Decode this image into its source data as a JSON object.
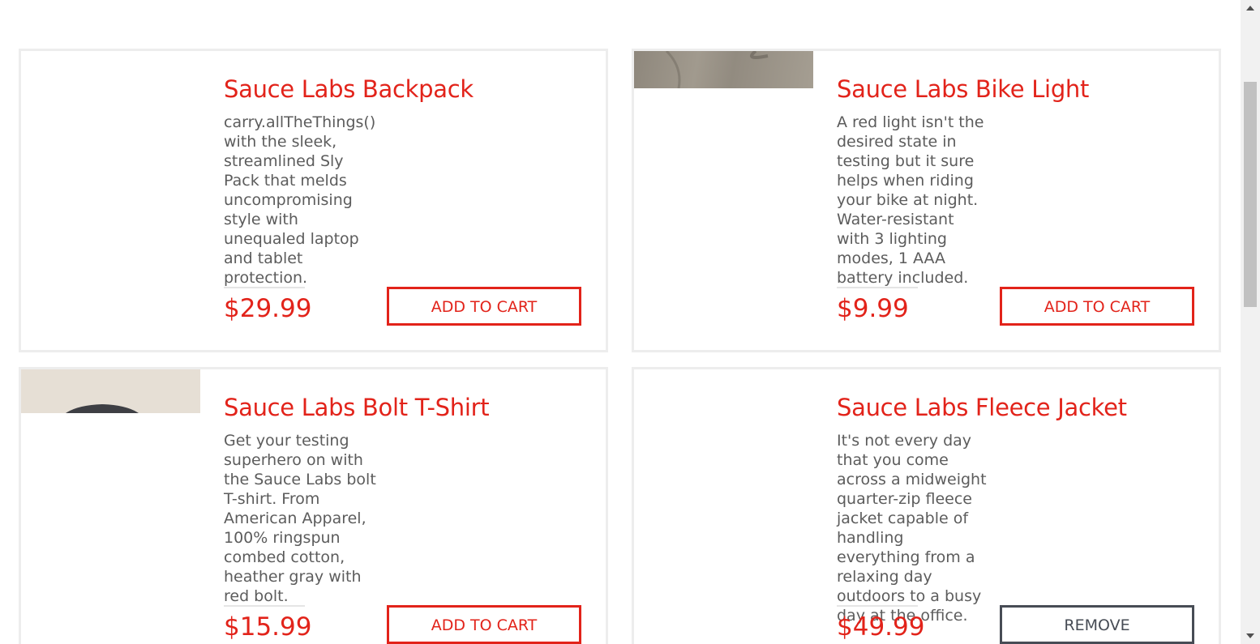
{
  "products": [
    {
      "name": "Sauce Labs Backpack",
      "description": "carry.allTheThings() with the sleek, streamlined Sly Pack that melds uncompromising style with unequaled laptop and tablet protection.",
      "price": "$29.99",
      "button": "ADD TO CART"
    },
    {
      "name": "Sauce Labs Bike Light",
      "description": "A red light isn't the desired state in testing but it sure helps when riding your bike at night. Water-resistant with 3 lighting modes, 1 AAA battery included.",
      "price": "$9.99",
      "button": "ADD TO CART"
    },
    {
      "name": "Sauce Labs Bolt T-Shirt",
      "description": "Get your testing superhero on with the Sauce Labs bolt T-shirt. From American Apparel, 100% ringspun combed cotton, heather gray with red bolt.",
      "price": "$15.99",
      "button": "ADD TO CART"
    },
    {
      "name": "Sauce Labs Fleece Jacket",
      "description": "It's not every day that you come across a midweight quarter-zip fleece jacket capable of handling everything from a relaxing day outdoors to a busy day at the office.",
      "price": "$49.99",
      "button": "REMOVE"
    }
  ],
  "colors": {
    "accent": "#e2231a",
    "text_muted": "#5c5c5c",
    "remove_border": "#474c55",
    "card_border": "#ededed"
  }
}
